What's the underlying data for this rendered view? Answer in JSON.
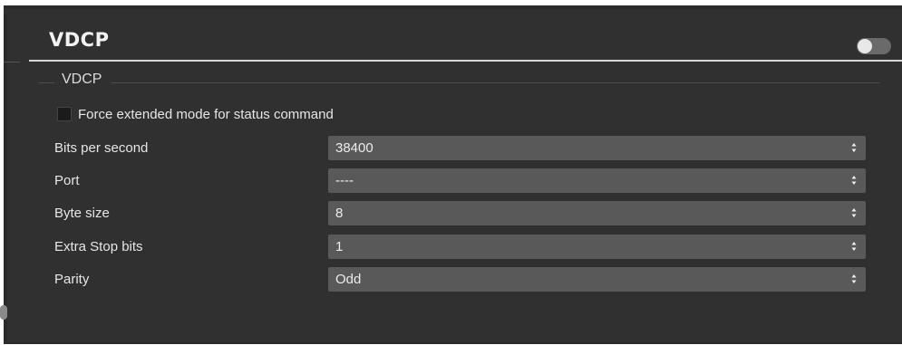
{
  "panel": {
    "title": "VDCP",
    "enabled": false
  },
  "group": {
    "title": "VDCP"
  },
  "checkbox": {
    "label": "Force extended mode for status command",
    "checked": false
  },
  "fields": [
    {
      "label": "Bits per second",
      "value": "38400"
    },
    {
      "label": "Port",
      "value": "----"
    },
    {
      "label": "Byte size",
      "value": "8"
    },
    {
      "label": "Extra Stop bits",
      "value": "1"
    },
    {
      "label": "Parity",
      "value": "Odd"
    }
  ],
  "colors": {
    "background": "#303030",
    "select_background": "#595959",
    "text": "#e6e6e6",
    "header_line": "#d8d8d8",
    "toggle_off": "#6a6a6a"
  },
  "icons": {
    "select_arrow": "updown-arrow-icon",
    "toggle": "toggle-switch"
  }
}
